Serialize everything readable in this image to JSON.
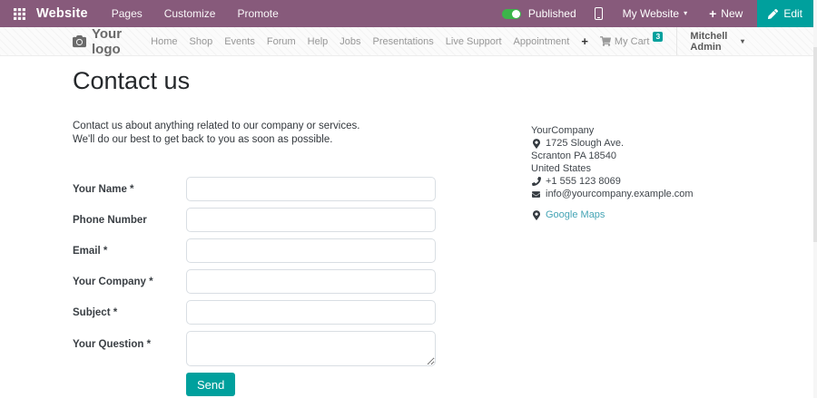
{
  "topbar": {
    "title": "Website",
    "menu": [
      "Pages",
      "Customize",
      "Promote"
    ],
    "published_label": "Published",
    "my_website_label": "My Website",
    "new_label": "New",
    "edit_label": "Edit"
  },
  "navbar": {
    "logo_text": "Your logo",
    "menu": [
      "Home",
      "Shop",
      "Events",
      "Forum",
      "Help",
      "Jobs",
      "Presentations",
      "Live Support",
      "Appointment"
    ],
    "cart_label": "My Cart",
    "cart_count": "3",
    "user_label": "Mitchell Admin"
  },
  "main": {
    "title": "Contact us",
    "intro_line1": "Contact us about anything related to our company or services.",
    "intro_line2": "We'll do our best to get back to you as soon as possible.",
    "form": {
      "fields": [
        {
          "label": "Your Name *",
          "type": "input"
        },
        {
          "label": "Phone Number",
          "type": "input"
        },
        {
          "label": "Email *",
          "type": "input"
        },
        {
          "label": "Your Company *",
          "type": "input"
        },
        {
          "label": "Subject *",
          "type": "input"
        },
        {
          "label": "Your Question *",
          "type": "textarea"
        }
      ],
      "submit_label": "Send"
    },
    "contact_info": {
      "company": "YourCompany",
      "address_line1": "1725 Slough Ave.",
      "address_line2": "Scranton PA 18540",
      "address_line3": "United States",
      "phone": "+1 555 123 8069",
      "email": "info@yourcompany.example.com",
      "map_link_label": "Google Maps"
    }
  },
  "colors": {
    "topbar_purple": "#875A7B",
    "accent_teal": "#00A09D",
    "toggle_green": "#3CB54A",
    "link_teal": "#45A4B5"
  }
}
